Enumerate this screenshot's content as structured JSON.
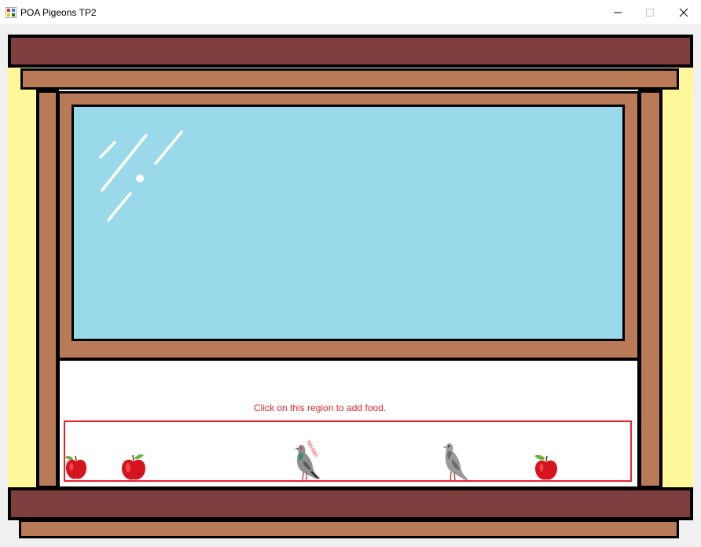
{
  "window": {
    "title": "POA Pigeons TP2",
    "controls": [
      "minimize",
      "maximize",
      "close"
    ]
  },
  "scene": {
    "food_region_label": "Click on this region to add food.",
    "eating_label": "NHAM!",
    "items": [
      {
        "type": "apple",
        "icon": "apple-icon"
      },
      {
        "type": "apple",
        "icon": "apple-icon"
      },
      {
        "type": "pigeon",
        "icon": "pigeon-icon",
        "state": "eating"
      },
      {
        "type": "pigeon",
        "icon": "pigeon-icon",
        "state": "idle"
      },
      {
        "type": "apple",
        "icon": "apple-icon"
      }
    ]
  },
  "colors": {
    "wall": "#fff799",
    "frame_dark": "#7f3f3f",
    "frame_light": "#b97a57",
    "glass": "#99d9ea",
    "food_region_border": "#e8202e",
    "label_text": "#e8202e"
  }
}
